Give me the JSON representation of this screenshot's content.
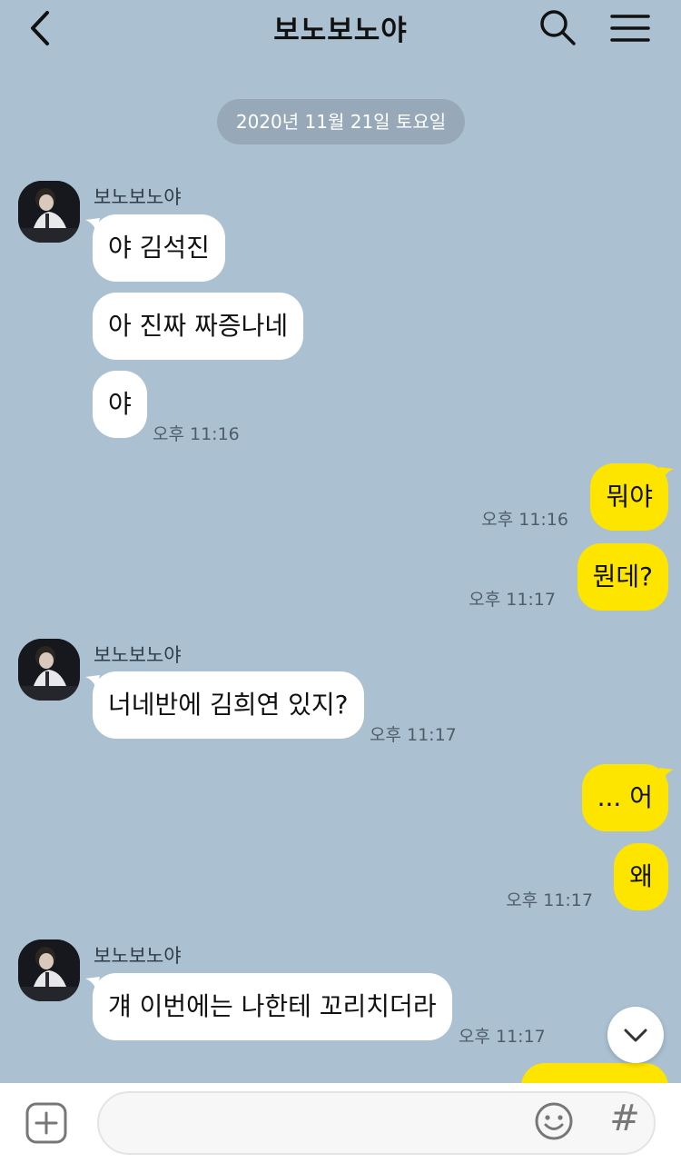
{
  "header": {
    "title": "보노보노야"
  },
  "date_divider": "2020년 11월 21일 토요일",
  "icons": {
    "back": "chevron-left-icon",
    "search": "search-icon",
    "menu": "hamburger-menu-icon",
    "scroll": "chevron-down-icon",
    "plus": "plus-square-icon",
    "emoji": "smiley-icon",
    "hash": "#"
  },
  "colors": {
    "background": "#abc1d1",
    "outgoing_bubble": "#fee500",
    "incoming_bubble": "#ffffff"
  },
  "messages": [
    {
      "sender": "보노보노야"
    },
    {
      "text": "야 김석진"
    },
    {
      "text": "아 진짜 짜증나네"
    },
    {
      "text": "야",
      "time": "오후 11:16"
    },
    {
      "text": "뭐야",
      "time": "오후 11:16"
    },
    {
      "text": "뭔데?",
      "time": "오후 11:17"
    },
    {
      "sender": "보노보노야"
    },
    {
      "text": "너네반에 김희연 있지?",
      "time": "오후 11:17"
    },
    {
      "text": "... 어"
    },
    {
      "text": "왜",
      "time": "오후 11:17"
    },
    {
      "sender": "보노보노야"
    },
    {
      "text": "걔 이번에는 나한테 꼬리치더라",
      "time": "오후 11:17"
    }
  ],
  "input": {
    "value": "",
    "placeholder": ""
  }
}
